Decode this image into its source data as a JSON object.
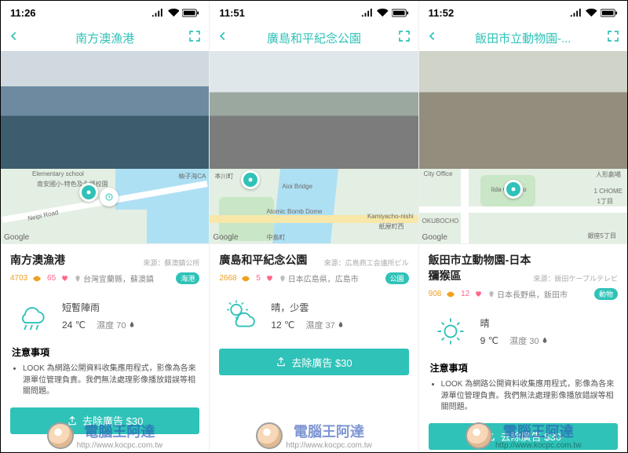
{
  "watermark": {
    "brand": "電腦王阿達",
    "url": "http://www.kocpc.com.tw"
  },
  "notes_heading": "注意事項",
  "note_text": "LOOK 為網路公開資料收集應用程式，影像為各來源單位管理負責。我們無法處理影像播放錯誤等相關問題。",
  "remove_ad_label": "去除廣告 $30",
  "humidity_label": "濕度",
  "google_credit": "Google",
  "screens": [
    {
      "time": "11:26",
      "title": "南方澳漁港",
      "map_labels": [
        "Elementary school",
        "南安國小-特色及永續校園",
        "Neipi Road",
        "柚子海CA"
      ],
      "name": "南方澳漁港",
      "source": "來源：蘇澳鎮公所",
      "views": "4703",
      "likes": "65",
      "loc_text": "台灣宜蘭縣，蘇澳鎮",
      "badge": "海港",
      "weather": {
        "desc": "短暫陣雨",
        "temp": "24 ℃",
        "humidity": "70"
      },
      "icon": "rain"
    },
    {
      "time": "11:51",
      "title": "廣島和平紀念公園",
      "map_labels": [
        "本川町",
        "Aioi Bridge",
        "Atomic Bomb Dome",
        "Kamiyacho-nishi",
        "紙屋町西",
        "中島町"
      ],
      "name": "廣島和平紀念公園",
      "source": "來源：広島商工会議所ビル",
      "views": "2668",
      "likes": "5",
      "loc_text": "日本広島県，広島市",
      "badge": "公園",
      "weather": {
        "desc": "晴，少雲",
        "temp": "12 ℃",
        "humidity": "37"
      },
      "icon": "partly"
    },
    {
      "time": "11:52",
      "title": "飯田市立動物園-...",
      "map_labels": [
        "City Office",
        "人形劇場",
        "Iida City Zoo",
        "1 CHOME",
        "1丁目",
        "OKUBOCHO",
        "銀座5丁目"
      ],
      "name": "飯田市立動物園-日本獼猴區",
      "source": "來源：飯田ケーブルテレビ",
      "views": "908",
      "likes": "12",
      "loc_text": "日本長野県，飯田市",
      "badge": "動物",
      "weather": {
        "desc": "晴",
        "temp": "9 ℃",
        "humidity": "30"
      },
      "icon": "sunny"
    }
  ]
}
